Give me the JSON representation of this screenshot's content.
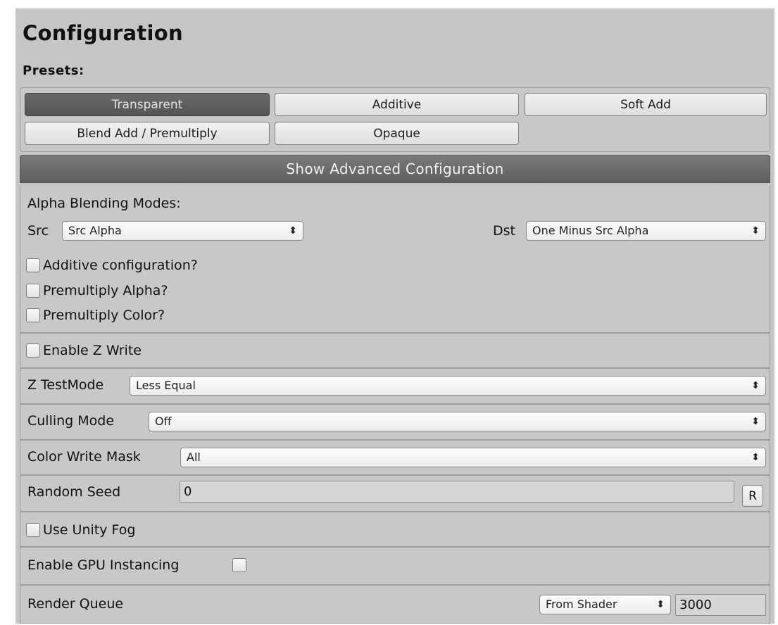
{
  "header": {
    "title": "Configuration"
  },
  "presets": {
    "label": "Presets:",
    "buttons": [
      "Transparent",
      "Additive",
      "Soft Add",
      "Blend Add / Premultiply",
      "Opaque"
    ],
    "active": "Transparent"
  },
  "advanced_toggle": {
    "label": "Show Advanced Configuration"
  },
  "alpha_blending": {
    "heading": "Alpha Blending Modes:",
    "src_label": "Src",
    "src_value": "Src Alpha",
    "dst_label": "Dst",
    "dst_value": "One Minus Src Alpha",
    "checkboxes": [
      "Additive configuration?",
      "Premultiply Alpha?",
      "Premultiply Color?"
    ]
  },
  "z_write": {
    "label": "Enable Z Write"
  },
  "z_test": {
    "label": "Z TestMode",
    "value": "Less Equal"
  },
  "culling": {
    "label": "Culling Mode",
    "value": "Off"
  },
  "color_mask": {
    "label": "Color Write Mask",
    "value": "All"
  },
  "random_seed": {
    "label": "Random Seed",
    "value": "0",
    "reset_label": "R"
  },
  "fog": {
    "label": "Use Unity Fog"
  },
  "gpu_instancing": {
    "label": "Enable GPU Instancing"
  },
  "render_queue": {
    "label": "Render Queue",
    "mode": "From Shader",
    "value": "3000"
  },
  "icons": {
    "dropdown_arrow": "updown-arrow-icon"
  },
  "colors": {
    "active_button": "#5f5f5f",
    "panel_bg": "#c6c6c6",
    "advanced_bar": "#6b6b6b"
  }
}
